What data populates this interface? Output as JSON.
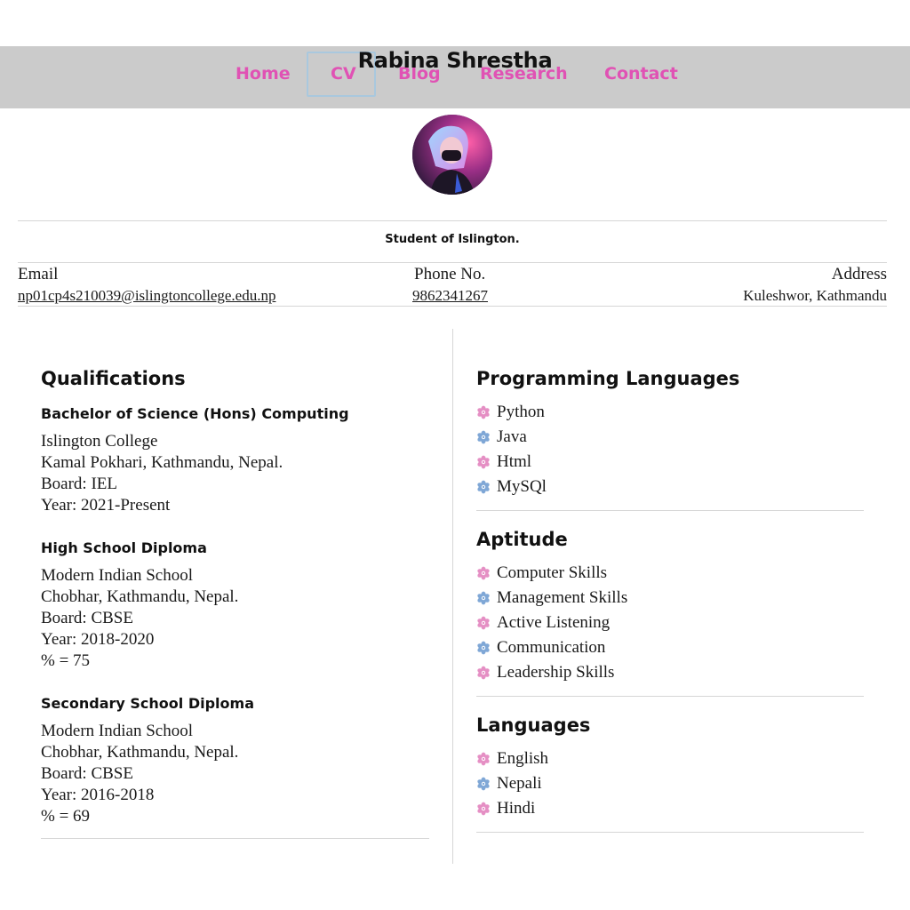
{
  "header": {
    "site_title": "Rabina Shrestha",
    "nav": [
      "Home",
      "CV",
      "Blog",
      "Research",
      "Contact"
    ],
    "active_nav": "CV",
    "colors": {
      "bar": "#cbcbcb",
      "link": "#e052b4",
      "active_border": "#a9c8de"
    }
  },
  "profile": {
    "avatar_icon": "profile-photo",
    "subtitle": "Student of Islington."
  },
  "contact": {
    "email_label": "Email",
    "email_value": "np01cp4s210039@islingtoncollege.edu.np",
    "phone_label": "Phone No.",
    "phone_value": "9862341267",
    "address_label": "Address",
    "address_value": "Kuleshwor, Kathmandu"
  },
  "qualifications": {
    "heading": "Qualifications",
    "items": [
      {
        "title": "Bachelor of Science (Hons) Computing",
        "lines": [
          "Islington College",
          "Kamal Pokhari, Kathmandu, Nepal.",
          "Board: IEL",
          "Year: 2021-Present"
        ]
      },
      {
        "title": "High School Diploma",
        "lines": [
          "Modern Indian School",
          "Chobhar, Kathmandu, Nepal.",
          "Board: CBSE",
          "Year: 2018-2020",
          "% = 75"
        ]
      },
      {
        "title": "Secondary School Diploma",
        "lines": [
          "Modern Indian School",
          "Chobhar, Kathmandu, Nepal.",
          "Board: CBSE",
          "Year: 2016-2018",
          "% = 69"
        ]
      }
    ]
  },
  "skills": [
    {
      "heading": "Programming Languages",
      "items": [
        "Python",
        "Java",
        "Html",
        "MySQl"
      ]
    },
    {
      "heading": "Aptitude",
      "items": [
        "Computer Skills",
        "Management Skills",
        "Active Listening",
        "Communication",
        "Leadership Skills"
      ]
    },
    {
      "heading": "Languages",
      "items": [
        "English",
        "Nepali",
        "Hindi"
      ]
    }
  ],
  "bullet_icon": "flower-icon",
  "bullet_colors": [
    "#e58fc4",
    "#7fa7d6"
  ]
}
